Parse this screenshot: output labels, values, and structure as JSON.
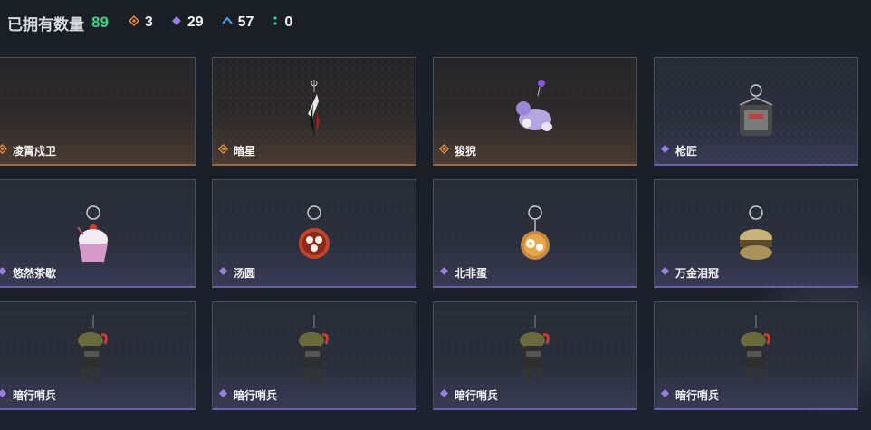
{
  "header": {
    "owned_label": "已拥有数量",
    "owned_count": "89",
    "rarity_stats": [
      {
        "icon": "orange-diamond-icon",
        "color": "#e0863e",
        "value": "3"
      },
      {
        "icon": "purple-diamond-icon",
        "color": "#9b7fe0",
        "value": "29"
      },
      {
        "icon": "blue-chevron-icon",
        "color": "#4aa3e8",
        "value": "57"
      },
      {
        "icon": "green-dots-icon",
        "color": "#37d58b",
        "value": "0"
      }
    ]
  },
  "colors": {
    "orange": "#e0863e",
    "purple": "#9b7fe0"
  },
  "items": [
    {
      "name": "凌霄戍卫",
      "rarity": "orange",
      "art": "none"
    },
    {
      "name": "暗星",
      "rarity": "orange",
      "art": "blade"
    },
    {
      "name": "狻猊",
      "rarity": "orange",
      "art": "beast"
    },
    {
      "name": "枪匠",
      "rarity": "purple",
      "art": "bag"
    },
    {
      "name": "悠然茶歇",
      "rarity": "purple",
      "art": "cupcake"
    },
    {
      "name": "汤圆",
      "rarity": "purple",
      "art": "bowl"
    },
    {
      "name": "北非蛋",
      "rarity": "purple",
      "art": "pan"
    },
    {
      "name": "万金泪冠",
      "rarity": "purple",
      "art": "burger"
    },
    {
      "name": "暗行哨兵",
      "rarity": "purple",
      "art": "soldier"
    },
    {
      "name": "暗行哨兵",
      "rarity": "purple",
      "art": "soldier"
    },
    {
      "name": "暗行哨兵",
      "rarity": "purple",
      "art": "soldier"
    },
    {
      "name": "暗行哨兵",
      "rarity": "purple",
      "art": "soldier"
    }
  ]
}
